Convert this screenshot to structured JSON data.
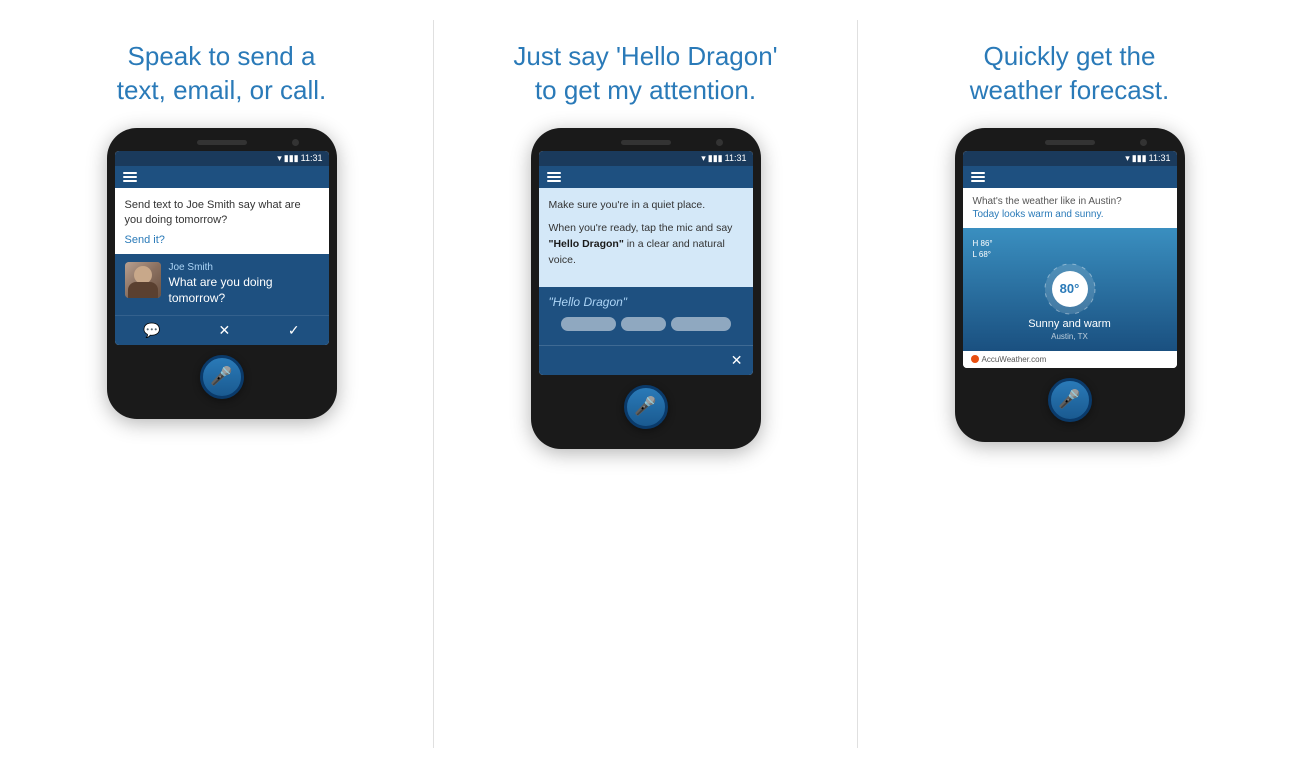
{
  "panels": [
    {
      "id": "panel1",
      "title": "Speak to send a\ntext, email, or call.",
      "phone": {
        "status_time": "11:31",
        "app_bar_visible": true,
        "content_type": "messaging",
        "chat_text": "Send text to Joe Smith say what are you doing tomorrow?",
        "send_it_label": "Send it?",
        "contact_name": "Joe Smith",
        "message_text": "What are you doing tomorrow?",
        "actions": [
          "chat",
          "close",
          "check"
        ]
      }
    },
    {
      "id": "panel2",
      "title": "Just say 'Hello Dragon'\nto get my attention.",
      "phone": {
        "status_time": "11:31",
        "app_bar_visible": true,
        "content_type": "voice_setup",
        "instruction1": "Make sure you're in a quiet place.",
        "instruction2_pre": "When you're ready, tap the mic and say ",
        "instruction2_bold": "\"Hello Dragon\"",
        "instruction2_post": " in a clear and natural voice.",
        "voice_prompt": "\"Hello Dragon\"",
        "close_visible": true
      }
    },
    {
      "id": "panel3",
      "title": "Quickly get the\nweather forecast.",
      "phone": {
        "status_time": "11:31",
        "app_bar_visible": true,
        "content_type": "weather",
        "question": "What's the weather like in Austin?",
        "answer": "Today looks warm and sunny.",
        "high": "H 86°",
        "low": "L 68°",
        "temperature": "80°",
        "description": "Sunny and warm",
        "location": "Austin, TX",
        "accuweather": "AccuWeather.com"
      }
    }
  ]
}
